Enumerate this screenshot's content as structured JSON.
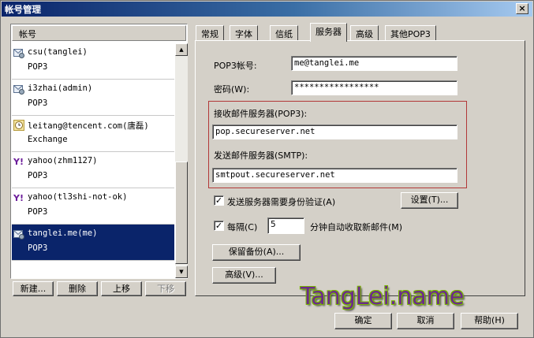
{
  "window": {
    "title": "帐号管理",
    "close_glyph": "×"
  },
  "accounts": {
    "header": "帐号",
    "items": [
      {
        "name": "csu(tanglei)",
        "type": "POP3",
        "icon": "pop3-account-icon",
        "selected": false
      },
      {
        "name": "i3zhai(admin)",
        "type": "POP3",
        "icon": "pop3-account-icon",
        "selected": false
      },
      {
        "name": "leitang@tencent.com(唐磊)",
        "type": "Exchange",
        "icon": "exchange-clock-icon",
        "selected": false
      },
      {
        "name": "yahoo(zhm1127)",
        "type": "POP3",
        "icon": "yahoo-icon",
        "selected": false
      },
      {
        "name": "yahoo(tl3shi-not-ok)",
        "type": "POP3",
        "icon": "yahoo-icon",
        "selected": false
      },
      {
        "name": "tanglei.me(me)",
        "type": "POP3",
        "icon": "pop3-account-icon",
        "selected": true
      }
    ],
    "buttons": {
      "new": "新建...",
      "delete": "删除",
      "move_up": "上移",
      "move_down": "下移"
    }
  },
  "tabs": [
    "常规",
    "字体",
    "信纸",
    "服务器",
    "高级",
    "其他POP3"
  ],
  "active_tab": "服务器",
  "server": {
    "pop3_account_label": "POP3帐号:",
    "pop3_account_value": "me@tanglei.me",
    "password_label": "密码(W):",
    "password_value": "*****************",
    "incoming_label": "接收邮件服务器(POP3):",
    "incoming_value": "pop.secureserver.net",
    "outgoing_label": "发送邮件服务器(SMTP):",
    "outgoing_value": "smtpout.secureserver.net",
    "smtp_auth_label": "发送服务器需要身份验证(A)",
    "smtp_auth_checked": true,
    "settings_button": "设置(T)...",
    "every_label": "每隔(C)",
    "every_checked": true,
    "every_value": "5",
    "every_suffix": "分钟自动收取新邮件(M)",
    "keep_backup_button": "保留备份(A)...",
    "advanced_button": "高级(V)..."
  },
  "footer": {
    "ok": "确定",
    "cancel": "取消",
    "help": "帮助(H)"
  },
  "watermark": "TangLei.name",
  "colors": {
    "selection": "#0a246a",
    "highlight_box": "#b23838"
  }
}
